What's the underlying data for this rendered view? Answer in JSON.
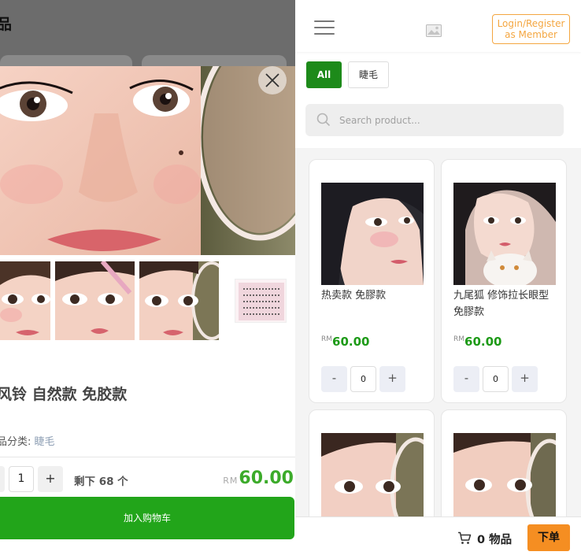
{
  "detail": {
    "header_title": "品",
    "name": "风铃 自然款 免胶款",
    "category_label": "品分类: ",
    "category_value": "睫毛",
    "quantity": "1",
    "plus": "+",
    "stock": "剩下 68 个",
    "currency": "RM",
    "price": "60.00",
    "add_to_cart": "加入购物车"
  },
  "header": {
    "login": "Login/Register as Member"
  },
  "categories": [
    {
      "label": "All",
      "active": true
    },
    {
      "label": "睫毛",
      "active": false
    }
  ],
  "search": {
    "placeholder": "Search product..."
  },
  "products": [
    {
      "name": "热卖款 免膠款",
      "currency": "RM",
      "price": "60.00",
      "quantity": "0",
      "minus": "-",
      "plus": "+"
    },
    {
      "name": "九尾狐 修饰拉长眼型 免膠款",
      "currency": "RM",
      "price": "60.00",
      "quantity": "0",
      "minus": "-",
      "plus": "+"
    }
  ],
  "footer": {
    "cart_count": "0 物品",
    "checkout": "下单"
  },
  "colors": {
    "accent_green": "#1d8a1a",
    "price_green": "#1d9a17",
    "cart_button": "#22a51a",
    "login_orange": "#f4a640",
    "checkout_orange": "#f58e22"
  },
  "icons": [
    "close-icon",
    "menu-icon",
    "image-placeholder-icon",
    "search-icon",
    "cart-icon"
  ]
}
